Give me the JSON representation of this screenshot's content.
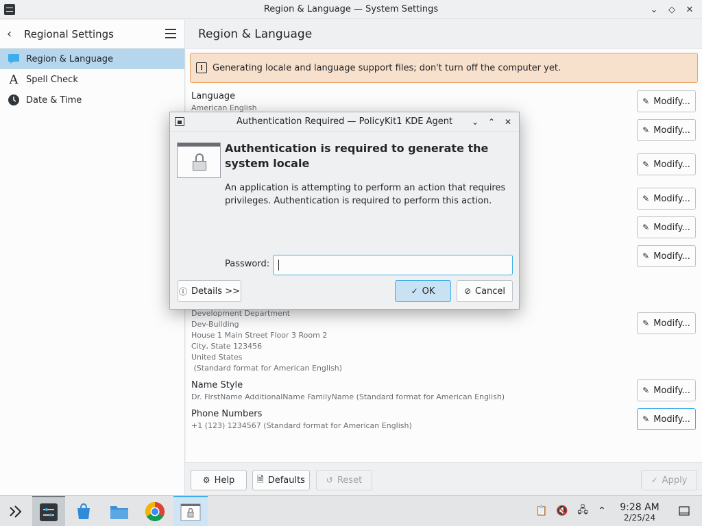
{
  "window": {
    "title": "Region & Language — System Settings"
  },
  "sidebar": {
    "title": "Regional Settings",
    "items": [
      {
        "label": "Region & Language",
        "icon": "chat-bubble-icon"
      },
      {
        "label": "Spell Check",
        "icon": "spell-check-icon"
      },
      {
        "label": "Date & Time",
        "icon": "clock-icon"
      }
    ]
  },
  "main": {
    "title": "Region & Language",
    "banner": "Generating locale and language support files; don't turn off the computer yet.",
    "language": {
      "label": "Language",
      "value": "American English"
    },
    "address": {
      "lines": [
        "Development Department",
        "Dev-Building",
        "House 1 Main Street Floor 3 Room 2",
        "City, State 123456",
        "United States",
        " (Standard format for American English)"
      ]
    },
    "name_style": {
      "label": "Name Style",
      "value": "Dr. FirstName AdditionalName FamilyName (Standard format for American English)"
    },
    "phone_numbers": {
      "label": "Phone Numbers",
      "value": "+1 (123) 1234567 (Standard format for American English)"
    },
    "modify_label": "Modify...",
    "footer": {
      "help": "Help",
      "defaults": "Defaults",
      "reset": "Reset",
      "apply": "Apply"
    }
  },
  "dialog": {
    "title": "Authentication Required — PolicyKit1 KDE Agent",
    "heading": "Authentication is required to generate the system locale",
    "message": "An application is attempting to perform an action that requires privileges. Authentication is required to perform this action.",
    "password_label": "Password:",
    "password_value": "",
    "details_button": "Details >>",
    "ok_button": "OK",
    "cancel_button": "Cancel"
  },
  "taskbar": {
    "time": "9:28 AM",
    "date": "2/25/24"
  }
}
